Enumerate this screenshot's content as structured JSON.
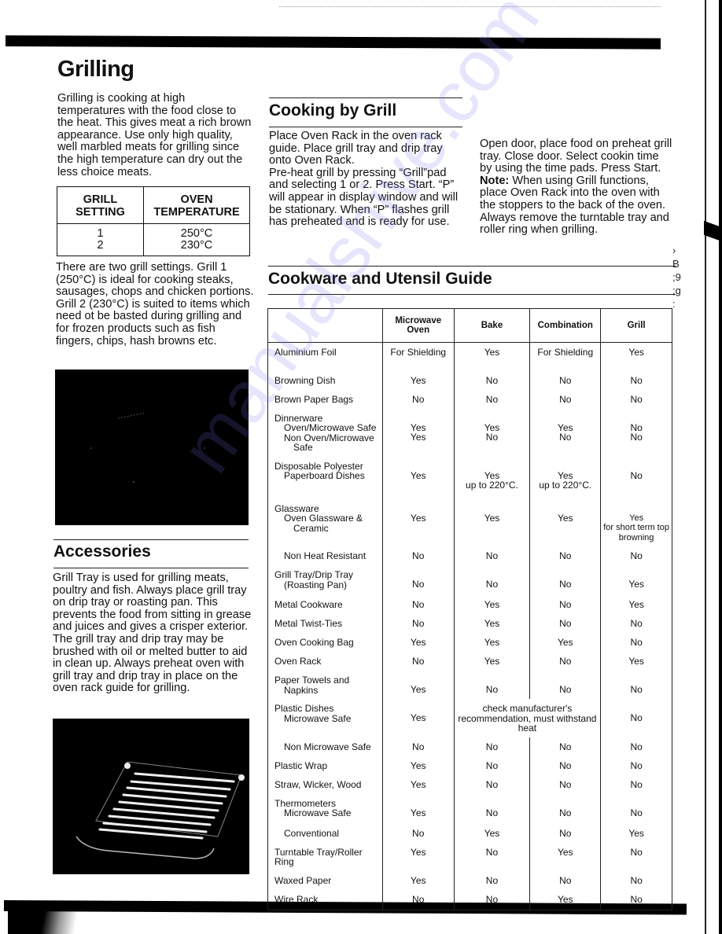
{
  "watermark": "manualshive.com",
  "grilling": {
    "title": "Grilling",
    "intro": "Grilling is cooking at high temperatures with the food close to the heat. This gives meat a rich brown appearance. Use only high quality, well marbled meats for grilling since the high temperature can dry out the less choice meats.",
    "table": {
      "headers": [
        "GRILL SETTING",
        "OVEN TEMPERATURE"
      ],
      "rows": [
        [
          "1",
          "250°C"
        ],
        [
          "2",
          "230°C"
        ]
      ]
    },
    "settings_text": "There are two grill settings. Grill 1 (250°C) is ideal for cooking steaks, sausages, chops and chicken portions. Grill 2 (230°C) is suited to items which need ot be basted during grilling and for frozen products such as fish fingers, chips, hash browns etc."
  },
  "accessories": {
    "title": "Accessories",
    "text": "Grill Tray is used for grilling meats, poultry and fish. Always place grill tray on drip tray or roasting pan. This prevents the food from sitting in grease and juices and gives a crisper exterior. The grill tray and drip tray may be brushed with oil or melted butter to aid in clean up. Always preheat oven with grill tray and drip tray in place on the oven rack guide for grilling."
  },
  "cooking_by_grill": {
    "title": "Cooking by Grill",
    "text1": "Place Oven Rack in the oven rack guide. Place grill tray and drip tray onto Oven Rack.",
    "text2": "Pre-heat grill by pressing “Grill”pad and selecting 1 or 2. Press Start. “P” will appear in display window and will be stationary. When “P” flashes grill has preheated and is ready for use.",
    "text3": "Open door, place food on preheat grill tray. Close door. Select cookin time by using the time pads. Press Start.",
    "note_label": "Note:",
    "note_text": " When using Grill functions, place Oven Rack into the oven with the stoppers to the back of the oven. Always remove the turntable tray and roller ring when grilling."
  },
  "guide": {
    "title": "Cookware and Utensil Guide",
    "headers": [
      "",
      "Microwave Oven",
      "Bake",
      "Combination",
      "Grill"
    ],
    "rows": [
      {
        "item": "Aluminium Foil",
        "mw": "For Shielding",
        "bake": "Yes",
        "combo": "For Shielding",
        "grill": "Yes"
      },
      {
        "item": "Browning Dish",
        "mw": "Yes",
        "bake": "No",
        "combo": "No",
        "grill": "No"
      },
      {
        "item": "Brown Paper Bags",
        "mw": "No",
        "bake": "No",
        "combo": "No",
        "grill": "No"
      },
      {
        "item": "Dinnerware",
        "sub1": "Oven/Microwave Safe",
        "sub2": "Non Oven/Microwave",
        "sub2b": "Safe",
        "mw": "Yes\nYes",
        "bake": "Yes\nNo",
        "combo": "Yes\nNo",
        "grill": "No\nNo"
      },
      {
        "item": "Disposable Polyester",
        "sub1": "Paperboard Dishes",
        "mw": "Yes",
        "bake": "Yes\nup to 220°C.",
        "combo": "Yes\nup to 220°C.",
        "grill": "No"
      },
      {
        "item": "Glassware",
        "sub1": "Oven Glassware &",
        "sub1b": "Ceramic",
        "mw": "Yes",
        "bake": "Yes",
        "combo": "Yes",
        "grill": "Yes\nfor short term top browning"
      },
      {
        "item": "Non Heat Resistant",
        "mw": "No",
        "bake": "No",
        "combo": "No",
        "grill": "No"
      },
      {
        "item": "Grill Tray/Drip Tray",
        "sub1": "(Roasting Pan)",
        "mw": "No",
        "bake": "No",
        "combo": "No",
        "grill": "Yes"
      },
      {
        "item": "Metal Cookware",
        "mw": "No",
        "bake": "Yes",
        "combo": "No",
        "grill": "Yes"
      },
      {
        "item": "Metal Twist-Ties",
        "mw": "No",
        "bake": "Yes",
        "combo": "No",
        "grill": "No"
      },
      {
        "item": "Oven Cooking Bag",
        "mw": "Yes",
        "bake": "Yes",
        "combo": "Yes",
        "grill": "No"
      },
      {
        "item": "Oven Rack",
        "mw": "No",
        "bake": "Yes",
        "combo": "No",
        "grill": "Yes"
      },
      {
        "item": "Paper Towels and",
        "sub1": "Napkins",
        "mw": "Yes",
        "bake": "No",
        "combo": "No",
        "grill": "No"
      },
      {
        "item": "Plastic Dishes",
        "sub1": "Microwave Safe",
        "mw": "Yes",
        "merged": "check manufacturer's recommendation, must withstand heat",
        "grill": "No"
      },
      {
        "item": "Non Microwave Safe",
        "mw": "No",
        "bake": "No",
        "combo": "No",
        "grill": "No"
      },
      {
        "item": "Plastic Wrap",
        "mw": "Yes",
        "bake": "No",
        "combo": "No",
        "grill": "No"
      },
      {
        "item": "Straw, Wicker, Wood",
        "mw": "Yes",
        "bake": "No",
        "combo": "No",
        "grill": "No"
      },
      {
        "item": "Thermometers",
        "sub1": "Microwave Safe",
        "mw": "Yes",
        "bake": "No",
        "combo": "No",
        "grill": "No"
      },
      {
        "item": "Conventional",
        "mw": "No",
        "bake": "Yes",
        "combo": "No",
        "grill": "Yes"
      },
      {
        "item": "Turntable Tray/Roller Ring",
        "mw": "Yes",
        "bake": "No",
        "combo": "Yes",
        "grill": "No"
      },
      {
        "item": "Waxed Paper",
        "mw": "Yes",
        "bake": "No",
        "combo": "No",
        "grill": "No"
      },
      {
        "item": "Wire Rack",
        "mw": "No",
        "bake": "No",
        "combo": "Yes",
        "grill": "No"
      }
    ]
  },
  "margin_marks": "›\nB\n;9\n;g\n:"
}
